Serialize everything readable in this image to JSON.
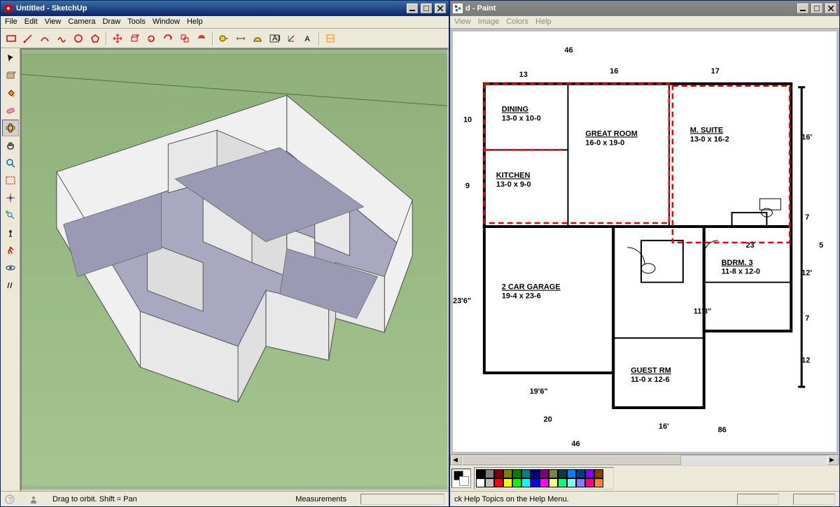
{
  "sketchup": {
    "title": "Untitled - SketchUp",
    "menus": [
      "File",
      "Edit",
      "View",
      "Camera",
      "Draw",
      "Tools",
      "Window",
      "Help"
    ],
    "toolbar_icons": [
      "rectangle",
      "line",
      "arc",
      "freehand",
      "circle",
      "polygon",
      "move",
      "rotate",
      "scale",
      "pushpull",
      "offset",
      "tape",
      "protractor",
      "dimension",
      "text",
      "paint",
      "axes",
      "orbit",
      "pan",
      "zoom",
      "zoom-ext",
      "section",
      "walk",
      "look"
    ],
    "side_icons": [
      "select",
      "component",
      "paint-bucket",
      "eraser",
      "move-tool",
      "orbit-tool",
      "hand",
      "zoom-tool",
      "zoom-window",
      "zoom-extents",
      "look-around",
      "iso",
      "rocket",
      "eye",
      "footprints"
    ],
    "status_hint": "Drag to orbit. Shift = Pan",
    "status_meas_label": "Measurements"
  },
  "paint": {
    "title": "d - Paint",
    "menus": [
      "View",
      "Image",
      "Colors",
      "Help"
    ],
    "colors": [
      "#000000",
      "#808080",
      "#800000",
      "#808000",
      "#008000",
      "#008080",
      "#000080",
      "#800080",
      "#808040",
      "#004040",
      "#0080ff",
      "#004080",
      "#8000ff",
      "#804000",
      "#ffffff",
      "#c0c0c0",
      "#ff0000",
      "#ffff00",
      "#00ff00",
      "#00ffff",
      "#0000ff",
      "#ff00ff",
      "#ffff80",
      "#00ff80",
      "#80ffff",
      "#8080ff",
      "#ff0080",
      "#ff8040"
    ],
    "status_help": "ck Help Topics on the Help Menu."
  },
  "floorplan": {
    "rooms": {
      "dining": {
        "label": "DINING",
        "dim": "13-0 x 10-0"
      },
      "great": {
        "label": "GREAT ROOM",
        "dim": "16-0 x 19-0"
      },
      "msuite": {
        "label": "M. SUITE",
        "dim": "13-0 x 16-2"
      },
      "kitchen": {
        "label": "KITCHEN",
        "dim": "13-0 x 9-0"
      },
      "garage": {
        "label": "2 CAR GARAGE",
        "dim": "19-4 x 23-6"
      },
      "bdrm3": {
        "label": "BDRM. 3",
        "dim": "11-8 x 12-0"
      },
      "guest": {
        "label": "GUEST RM",
        "dim": "11-0 x 12-6"
      }
    },
    "hand_dims": {
      "top": [
        "46",
        "13",
        "16",
        "17"
      ],
      "left": [
        "10",
        "9",
        "23'6\""
      ],
      "right": [
        "16'",
        "7",
        "5",
        "12'",
        "7",
        "12"
      ],
      "bottom": [
        "19'6\"",
        "20",
        "16'",
        "46",
        "86"
      ],
      "inner": [
        "11'8\"",
        "23"
      ]
    }
  }
}
